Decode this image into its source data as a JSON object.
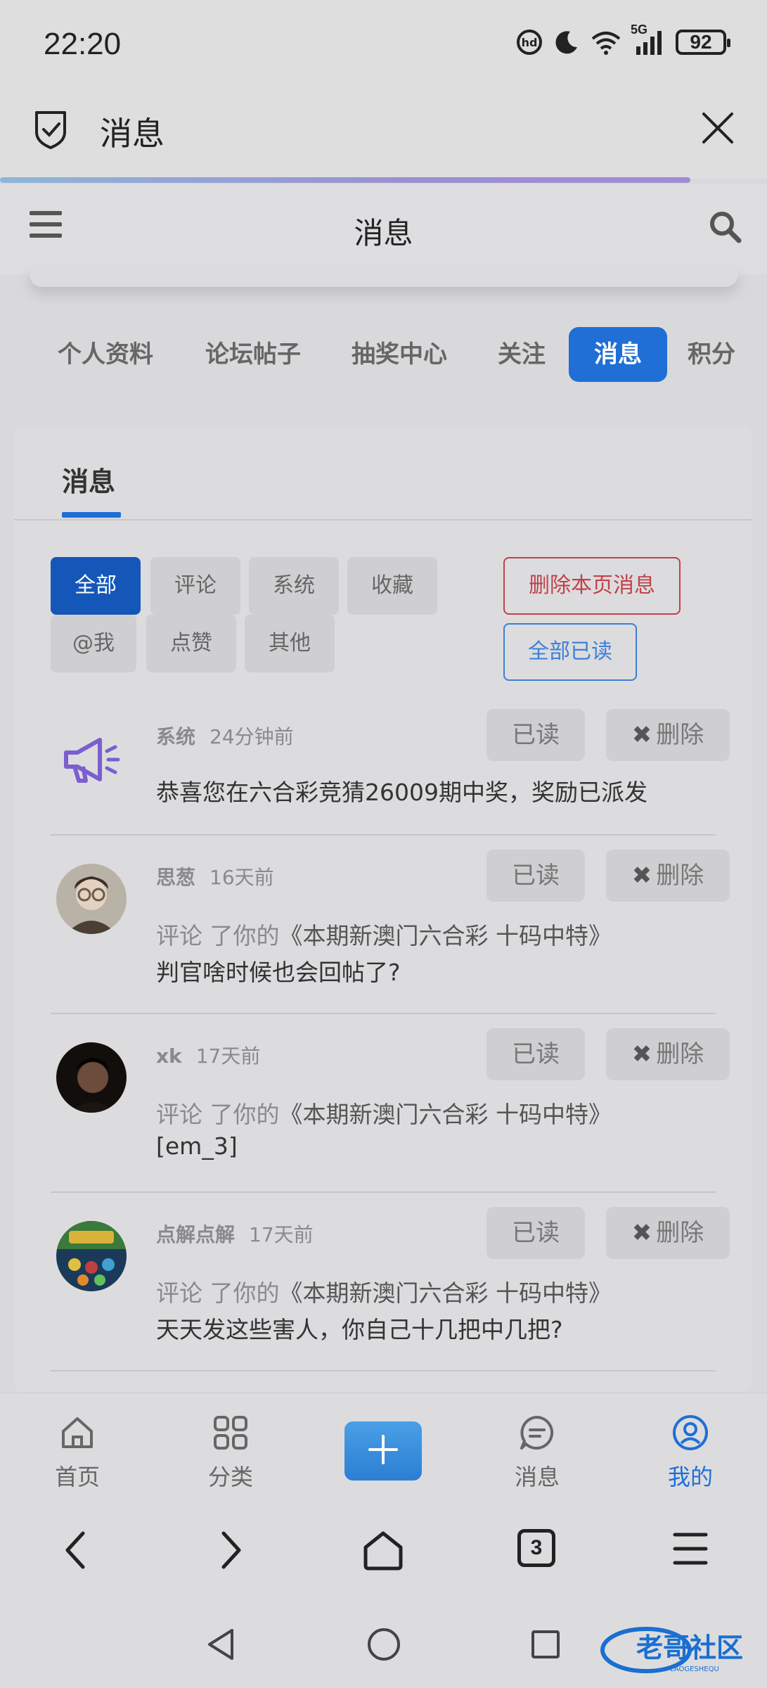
{
  "status_bar": {
    "time": "22:20",
    "network": "5G",
    "battery": "92",
    "icons": [
      "hd-call-icon",
      "moon-icon",
      "wifi-icon",
      "signal-icon",
      "battery-icon"
    ]
  },
  "browser": {
    "title": "消息",
    "page_load_progress": 0.9
  },
  "site_header": {
    "title": "消息"
  },
  "profile_tabs": [
    {
      "label": "个人资料",
      "active": false
    },
    {
      "label": "论坛帖子",
      "active": false
    },
    {
      "label": "抽奖中心",
      "active": false
    },
    {
      "label": "关注",
      "active": false
    },
    {
      "label": "消息",
      "active": true
    },
    {
      "label": "积分",
      "active": false
    }
  ],
  "card": {
    "tab_label": "消息",
    "filters": [
      {
        "label": "全部",
        "active": true
      },
      {
        "label": "评论",
        "active": false
      },
      {
        "label": "系统",
        "active": false
      },
      {
        "label": "收藏",
        "active": false
      },
      {
        "label": "@我",
        "active": false
      },
      {
        "label": "点赞",
        "active": false
      },
      {
        "label": "其他",
        "active": false
      }
    ],
    "delete_page_label": "删除本页消息",
    "mark_all_read_label": "全部已读",
    "read_label": "已读",
    "delete_label": "删除",
    "messages": [
      {
        "user": "系统",
        "time": "24分钟前",
        "text": "恭喜您在六合彩竞猜26009期中奖，奖励已派发"
      },
      {
        "user": "思葱",
        "time": "16天前",
        "action": "评论 了你的",
        "thread": "《本期新澳门六合彩 十码中特》",
        "text": "判官啥时候也会回帖了?"
      },
      {
        "user": "xk",
        "time": "17天前",
        "action": "评论 了你的",
        "thread": "《本期新澳门六合彩 十码中特》",
        "text": "[em_3]"
      },
      {
        "user": "点解点解",
        "time": "17天前",
        "action": "评论 了你的",
        "thread": "《本期新澳门六合彩 十码中特》",
        "text": "天天发这些害人，你自己十几把中几把?"
      }
    ]
  },
  "bottom_nav": [
    {
      "label": "首页",
      "icon": "home-icon"
    },
    {
      "label": "分类",
      "icon": "grid-icon"
    },
    {
      "label": "",
      "icon": "plus-icon"
    },
    {
      "label": "消息",
      "icon": "chat-icon"
    },
    {
      "label": "我的",
      "icon": "profile-icon",
      "active": true
    }
  ],
  "browser_nav": {
    "tab_count": "3"
  },
  "watermark": {
    "brand": "老哥社区",
    "sub": "LAOGESHEQU"
  }
}
